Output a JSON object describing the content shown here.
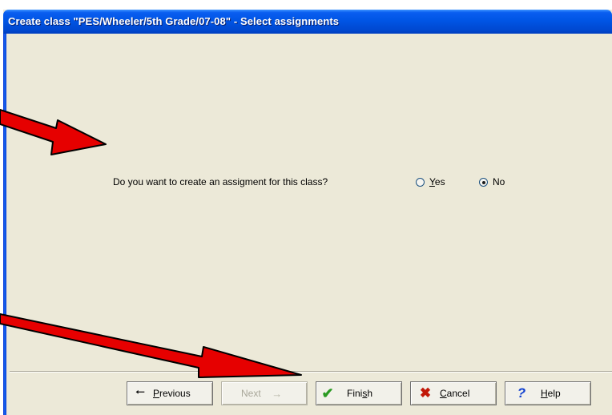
{
  "window": {
    "title": "Create class \"PES/Wheeler/5th Grade/07-08\" - Select assignments"
  },
  "question": {
    "text": "Do you want to create an assigment for this class?",
    "options": [
      {
        "label": "Yes",
        "mnemonic": "Y",
        "rest": "es",
        "selected": false
      },
      {
        "label": "No",
        "mnemonic": "",
        "rest": "No",
        "selected": true
      }
    ]
  },
  "buttons": {
    "previous": {
      "mnemonic": "P",
      "rest": "revious",
      "icon": "left-arrow-icon",
      "enabled": true
    },
    "next": {
      "label": "Next",
      "icon": "next-arrow-icon",
      "enabled": false
    },
    "finish": {
      "pre": "Fini",
      "mnemonic": "s",
      "post": "h",
      "icon": "checkmark-icon",
      "enabled": true
    },
    "cancel": {
      "mnemonic": "C",
      "rest": "ancel",
      "icon": "x-icon",
      "enabled": true
    },
    "help": {
      "mnemonic": "H",
      "rest": "elp",
      "icon": "question-mark-icon",
      "enabled": true
    }
  },
  "colors": {
    "titlebar": "#0055e5",
    "dialog_bg": "#ece9d8",
    "annotation_arrow": "#e60000"
  }
}
